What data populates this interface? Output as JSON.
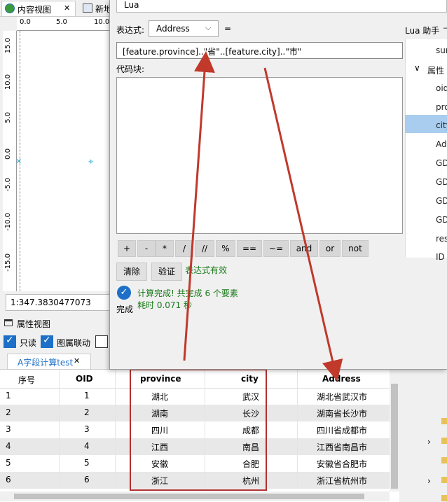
{
  "tabs": [
    {
      "label": "内容视图",
      "close": "✕"
    },
    {
      "label": "新地"
    }
  ],
  "ruler": {
    "top_ticks": [
      "0.0",
      "5.0",
      "10.0"
    ],
    "left_ticks": [
      "15.0",
      "10.0",
      "5.0",
      "0.0",
      "-5.0",
      "-10.0",
      "-15.0"
    ]
  },
  "scale_value": "1:347.3830477073",
  "attr_panel": {
    "title": "属性视图",
    "readonly_label": "只读",
    "link_label": "图属联动",
    "sheet_tab": "A字段计算test",
    "sheet_tab_close": "✕"
  },
  "dialog": {
    "title": "Lua",
    "expr_label": "表达式:",
    "field_select": "Address",
    "equals": "=",
    "expression": "[feature.province]..\"省\"..[feature.city]..\"市\"",
    "code_block_label": "代码块:",
    "operators": [
      "+",
      "-",
      "*",
      "/",
      "//",
      "%",
      "==",
      "~=",
      "and",
      "or",
      "not"
    ],
    "clear_button": "清除",
    "validate_button": "验证",
    "validate_status": "表达式有效",
    "result_line1": "计算完成! 共完成 6 个要素",
    "result_line2": "耗时 0.071 秒",
    "done_label": "完成"
  },
  "lua_helper": {
    "title": "Lua 助手",
    "items": [
      "sur",
      "属性",
      "oid",
      "pro",
      "city",
      "Add",
      "GD",
      "GD",
      "GD",
      "GD",
      "res",
      "ID"
    ],
    "selected_index": 4
  },
  "table": {
    "headers": [
      "序号",
      "OID",
      "province",
      "city",
      "Address"
    ],
    "rows": [
      [
        "1",
        "1",
        "湖北",
        "武汉",
        "湖北省武汉市"
      ],
      [
        "2",
        "2",
        "湖南",
        "长沙",
        "湖南省长沙市"
      ],
      [
        "3",
        "3",
        "四川",
        "成都",
        "四川省成都市"
      ],
      [
        "4",
        "4",
        "江西",
        "南昌",
        "江西省南昌市"
      ],
      [
        "5",
        "5",
        "安徽",
        "合肥",
        "安徽省合肥市"
      ],
      [
        "6",
        "6",
        "浙江",
        "杭州",
        "浙江省杭州市"
      ]
    ]
  },
  "colors": {
    "annotation": "#c0392b",
    "highlight_box": "#b03030",
    "selected_item": "#a9cdee",
    "success_text": "#1a7a1a"
  }
}
